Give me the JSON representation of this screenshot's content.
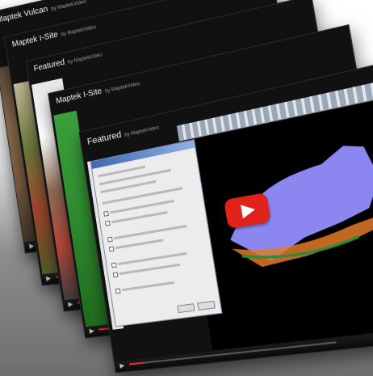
{
  "cards": [
    {
      "title": "Maptek Vulcan",
      "by": "by MaptekVideo"
    },
    {
      "title": "Maptek I-Site",
      "by": "by MaptekVideo"
    },
    {
      "title": "Featured",
      "by": "by MaptekVideo"
    },
    {
      "title": "Maptek I-Site",
      "by": "by MaptekVideo"
    },
    {
      "title": "Featured",
      "by": "by MaptekVideo"
    }
  ],
  "colors": {
    "progress": "#e52d27",
    "youtube_button": "#e0221c",
    "green_panel": "#2e8a2e",
    "mesh": "#8c87f0"
  },
  "icons": [
    "play-icon",
    "youtube-play-icon"
  ]
}
